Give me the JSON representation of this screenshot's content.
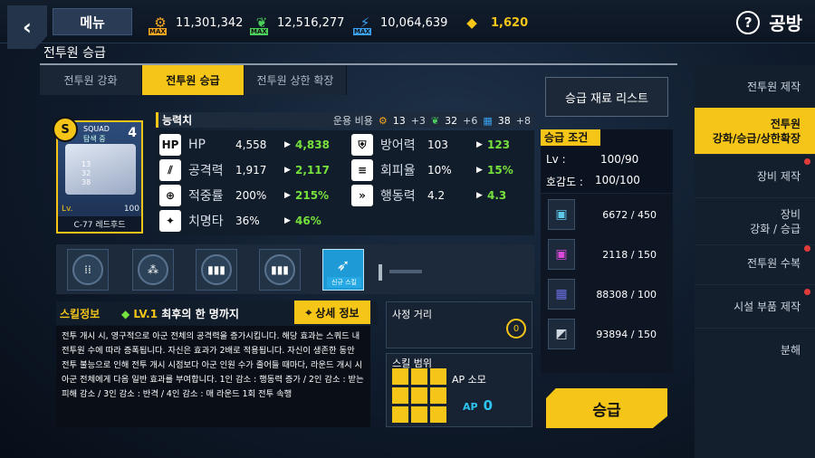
{
  "header": {
    "menu": "메뉴",
    "resources": [
      {
        "value": "11,301,342",
        "icon": "gear-icon",
        "max": "MAX"
      },
      {
        "value": "12,516,277",
        "icon": "leaf-icon",
        "max": "MAX"
      },
      {
        "value": "10,064,639",
        "icon": "bolt-icon",
        "max": "MAX"
      },
      {
        "value": "1,620",
        "icon": "gem-icon"
      }
    ],
    "page_title": "공방",
    "help": "?"
  },
  "subtitle": "전투원 승급",
  "tabs": [
    "전투원 강화",
    "전투원 승급",
    "전투원 상한 확장"
  ],
  "character": {
    "squad": "SQUAD",
    "squad_sub": "탐색 중",
    "num": "4",
    "badge": "S",
    "mini": [
      "13",
      "32",
      "38"
    ],
    "lv_label": "Lv.",
    "lv": "100",
    "name": "C-77 레드후드"
  },
  "ability": {
    "label": "능력치",
    "cost_label": "운용 비용",
    "costs": [
      {
        "v": "13",
        "d": "+3"
      },
      {
        "v": "32",
        "d": "+6"
      },
      {
        "v": "38",
        "d": "+8"
      }
    ]
  },
  "stats": [
    {
      "icon": "HP",
      "name": "HP",
      "value": "4,558",
      "next": "4,838"
    },
    {
      "icon": "⫽",
      "name": "공격력",
      "value": "1,917",
      "next": "2,117"
    },
    {
      "icon": "⊕",
      "name": "적중률",
      "value": "200%",
      "next": "215%"
    },
    {
      "icon": "✦",
      "name": "치명타",
      "value": "36%",
      "next": "46%"
    },
    {
      "icon": "⛨",
      "name": "방어력",
      "value": "103",
      "next": "123"
    },
    {
      "icon": "≡",
      "name": "회피율",
      "value": "10%",
      "next": "15%"
    },
    {
      "icon": "»",
      "name": "행동력",
      "value": "4.2",
      "next": "4.3"
    }
  ],
  "skills": {
    "new_tag": "신규 스킬"
  },
  "skill_info": {
    "title": "스킬정보",
    "lv": "LV.1",
    "name": "최후의 한 명까지",
    "detail": "상세 정보",
    "desc": "전투 개시 시, 영구적으로 아군 전체의 공격력을 증가시킵니다. 해당 효과는 스쿼드 내 전투원 수에 따라 증폭됩니다. 자신은 효과가 2배로 적용됩니다. 자신이 생존한 동안 전투 불능으로 인해 전투 개시 시점보다 아군 인원 수가 줄어들 때마다, 라운드 개시 시 아군 전체에게 다음 일반 효과를 부여합니다. 1인 감소 : 행동력 증가 / 2인 감소 : 받는 피해 감소 / 3인 감소 : 반격 / 4인 감소 : 매 라운드 1회 전투 속행"
  },
  "range": {
    "title": "사정 거리",
    "value": "0"
  },
  "scope": {
    "title": "스킬 범위",
    "ap_label": "AP 소모",
    "ap": "AP",
    "ap_value": "0"
  },
  "materials_button": "승급 재료 리스트",
  "condition": {
    "title": "승급 조건",
    "rows": [
      {
        "k": "Lv :",
        "v": "100/90"
      },
      {
        "k": "호감도 :",
        "v": "100/100"
      }
    ]
  },
  "materials": [
    {
      "value": "6672 / 450",
      "color": "#5ec8e8"
    },
    {
      "value": "2118 / 150",
      "color": "#d94adb"
    },
    {
      "value": "88308 / 100",
      "color": "#6b6fe0"
    },
    {
      "value": "93894 / 150",
      "color": "#cfd7e0"
    }
  ],
  "upgrade_button": "승급",
  "nav": [
    "전투원 제작",
    "전투원\n강화/승급/상한확장",
    "장비 제작",
    "장비\n강화 / 승급",
    "전투원 수복",
    "시설 부품 제작",
    "분해"
  ]
}
